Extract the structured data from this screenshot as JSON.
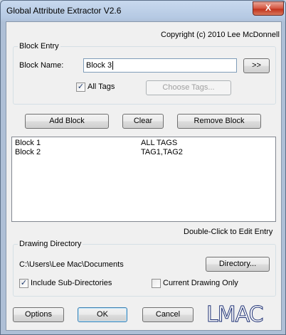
{
  "window": {
    "title": "Global Attribute Extractor V2.6",
    "close_glyph": "X"
  },
  "copyright": "Copyright (c) 2010 Lee McDonnell",
  "block_entry": {
    "group_label": "Block Entry",
    "name_label": "Block Name:",
    "name_value": "Block 3",
    "browse_label": ">>",
    "all_tags_label": "All Tags",
    "all_tags_checked": true,
    "choose_tags_label": "Choose Tags..."
  },
  "actions": {
    "add": "Add Block",
    "clear": "Clear",
    "remove": "Remove Block"
  },
  "block_list": {
    "rows": [
      {
        "name": "Block 1",
        "tags": "ALL TAGS"
      },
      {
        "name": "Block 2",
        "tags": "TAG1,TAG2"
      }
    ]
  },
  "hint": "Double-Click to Edit Entry",
  "drawing_directory": {
    "group_label": "Drawing Directory",
    "path": "C:\\Users\\Lee Mac\\Documents",
    "directory_button": "Directory...",
    "include_sub_label": "Include Sub-Directories",
    "include_sub_checked": true,
    "current_only_label": "Current Drawing Only",
    "current_only_checked": false
  },
  "footer": {
    "options": "Options",
    "ok": "OK",
    "cancel": "Cancel",
    "logo": "LMAC"
  },
  "colors": {
    "logo": "#1c2f73",
    "title_bar": "#b5c9e3",
    "close": "#c0321c"
  }
}
